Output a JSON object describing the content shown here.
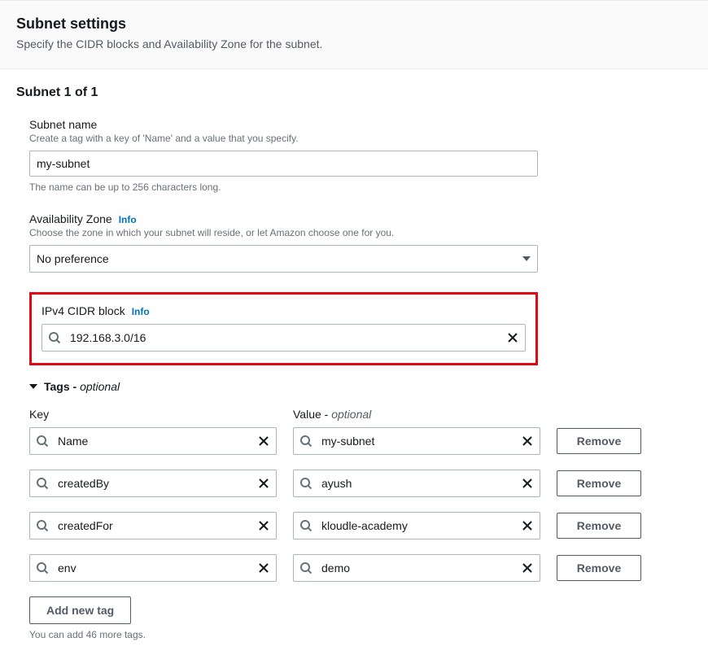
{
  "header": {
    "title": "Subnet settings",
    "description": "Specify the CIDR blocks and Availability Zone for the subnet."
  },
  "subnet": {
    "counter": "Subnet 1 of 1",
    "nameField": {
      "label": "Subnet name",
      "description": "Create a tag with a key of 'Name' and a value that you specify.",
      "value": "my-subnet",
      "hint": "The name can be up to 256 characters long."
    },
    "azField": {
      "label": "Availability Zone",
      "info": "Info",
      "description": "Choose the zone in which your subnet will reside, or let Amazon choose one for you.",
      "selected": "No preference"
    },
    "cidrField": {
      "label": "IPv4 CIDR block",
      "info": "Info",
      "value": "192.168.3.0/16"
    }
  },
  "tags": {
    "label": "Tags - ",
    "optional": "optional",
    "keyHeader": "Key",
    "valueHeader": "Value - ",
    "valueOptional": "optional",
    "removeLabel": "Remove",
    "rows": [
      {
        "key": "Name",
        "value": "my-subnet"
      },
      {
        "key": "createdBy",
        "value": "ayush"
      },
      {
        "key": "createdFor",
        "value": "kloudle-academy"
      },
      {
        "key": "env",
        "value": "demo"
      }
    ],
    "addButton": "Add new tag",
    "addHint": "You can add 46 more tags."
  }
}
